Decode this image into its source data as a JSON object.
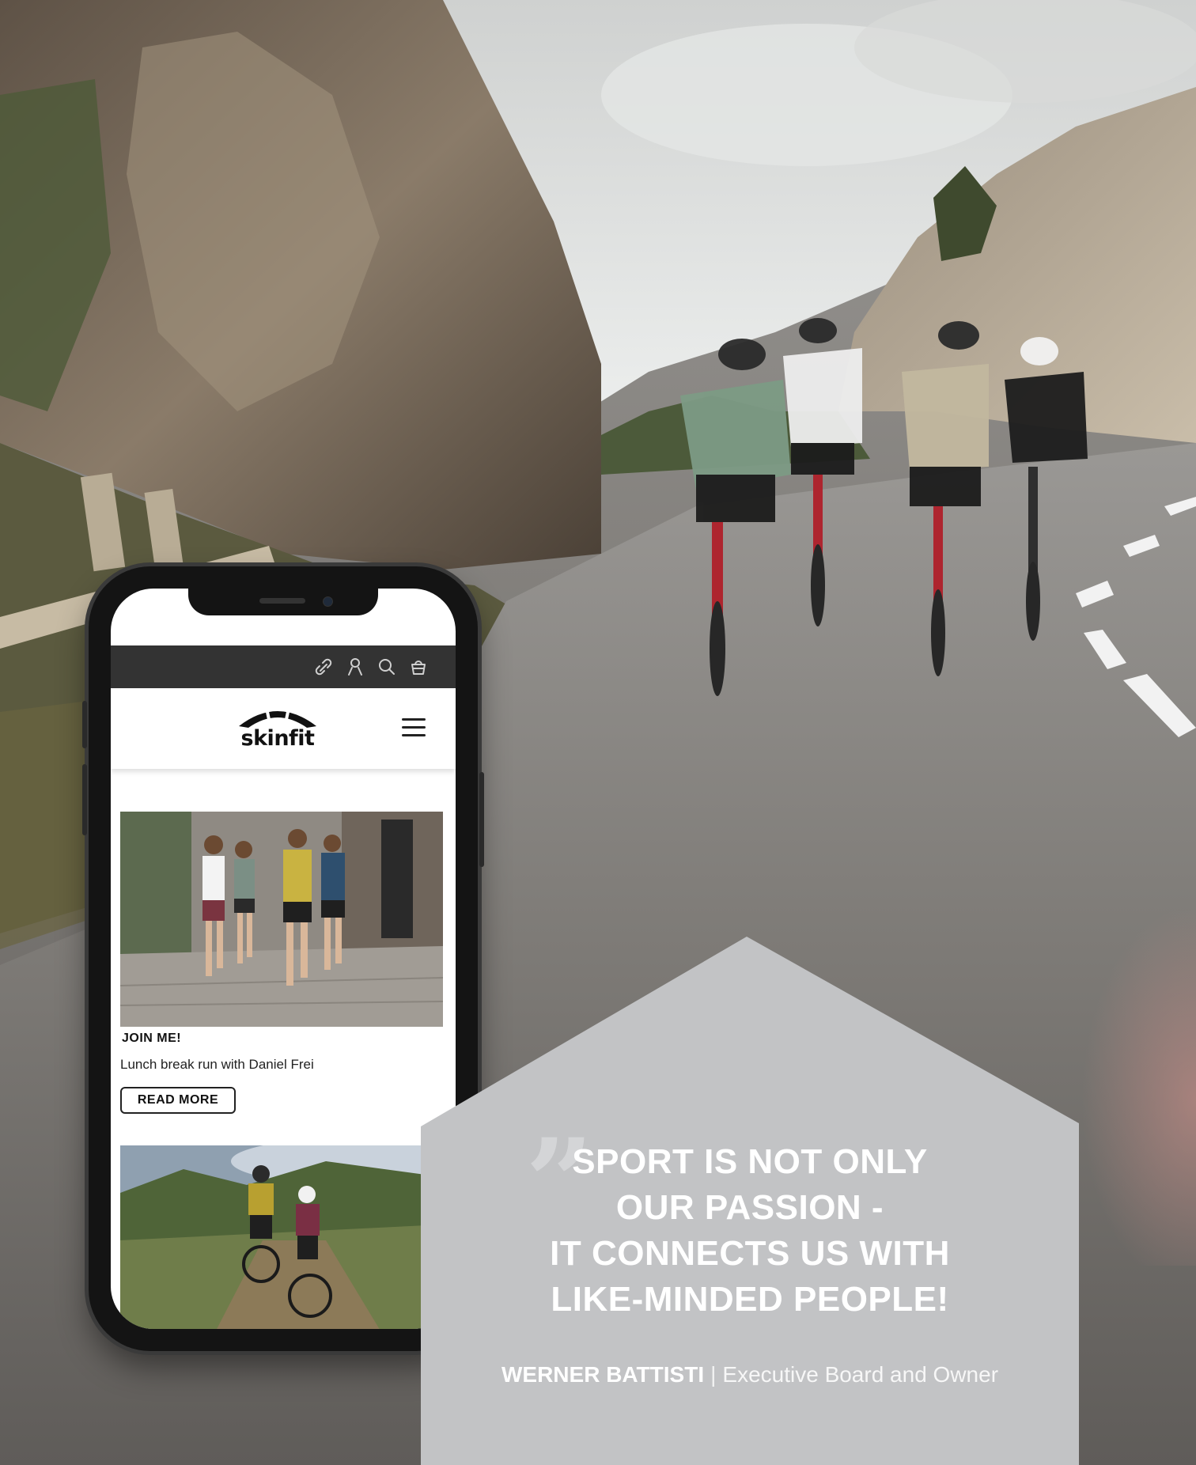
{
  "hero": {
    "scene": "cyclists-on-mountain-road"
  },
  "phone": {
    "topbar_icons": [
      "link-icon",
      "user-icon",
      "search-icon",
      "bag-icon"
    ],
    "logo_text": "skinfit",
    "menu_icon": "hamburger-menu-icon",
    "card1": {
      "title": "JOIN ME!",
      "subtitle": "Lunch break run with Daniel Frei",
      "button_label": "READ MORE"
    }
  },
  "quote": {
    "lines": [
      "SPORT IS NOT ONLY",
      "OUR PASSION -",
      "IT CONNECTS US WITH",
      "LIKE-MINDED PEOPLE!"
    ],
    "author_name": "WERNER BATTISTI",
    "author_separator": "|",
    "author_role": "Executive Board and Owner"
  },
  "colors": {
    "badge": "#c2c3c5",
    "topbar": "#333333",
    "phone_frame": "#141414"
  }
}
